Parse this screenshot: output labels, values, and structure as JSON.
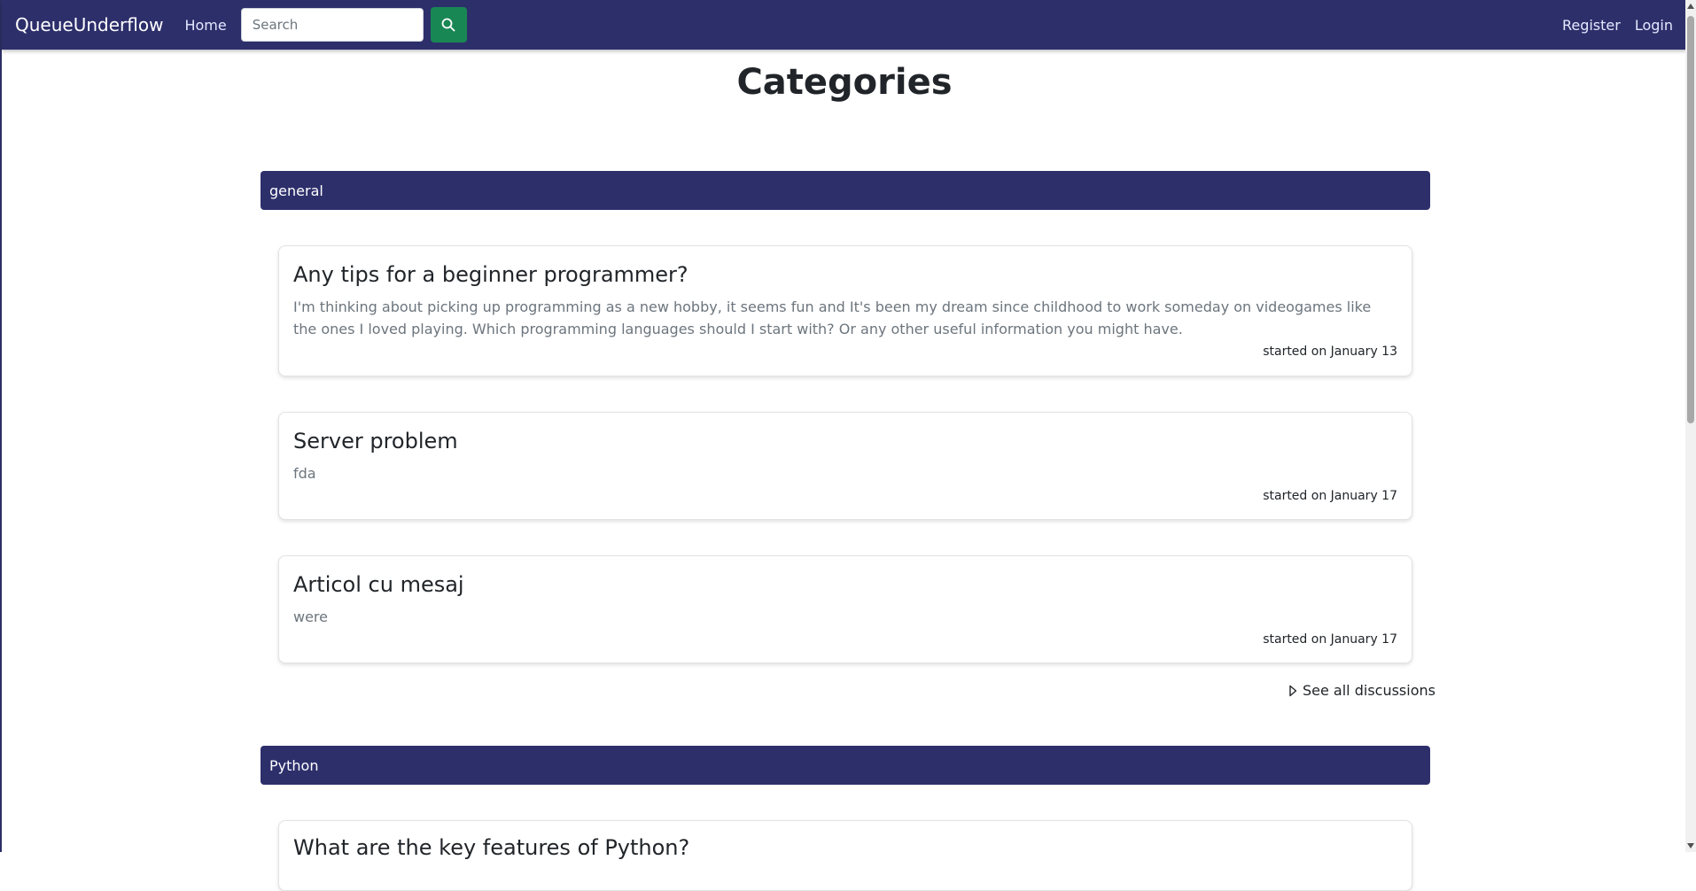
{
  "navbar": {
    "brand": "QueueUnderflow",
    "home": "Home",
    "search_placeholder": "Search",
    "register": "Register",
    "login": "Login"
  },
  "page": {
    "title": "Categories"
  },
  "categories": [
    {
      "name": "general",
      "discussions": [
        {
          "title": "Any tips for a beginner programmer?",
          "text": "I'm thinking about picking up programming as a new hobby, it seems fun and It's been my dream since childhood to work someday on videogames like the ones I loved playing. Which programming languages should I start with? Or any other useful information you might have.",
          "date": "started on January 13"
        },
        {
          "title": "Server problem",
          "text": "fda",
          "date": "started on January 17"
        },
        {
          "title": "Articol cu mesaj",
          "text": "were",
          "date": "started on January 17"
        }
      ],
      "see_all": "See all discussions"
    },
    {
      "name": "Python",
      "discussions": [
        {
          "title": "What are the key features of Python?"
        }
      ]
    }
  ],
  "colors": {
    "navbar": "#2d2f6b",
    "search_button": "#198754"
  },
  "icons": {
    "search": "search-icon",
    "see_all": "caret-right-icon"
  }
}
